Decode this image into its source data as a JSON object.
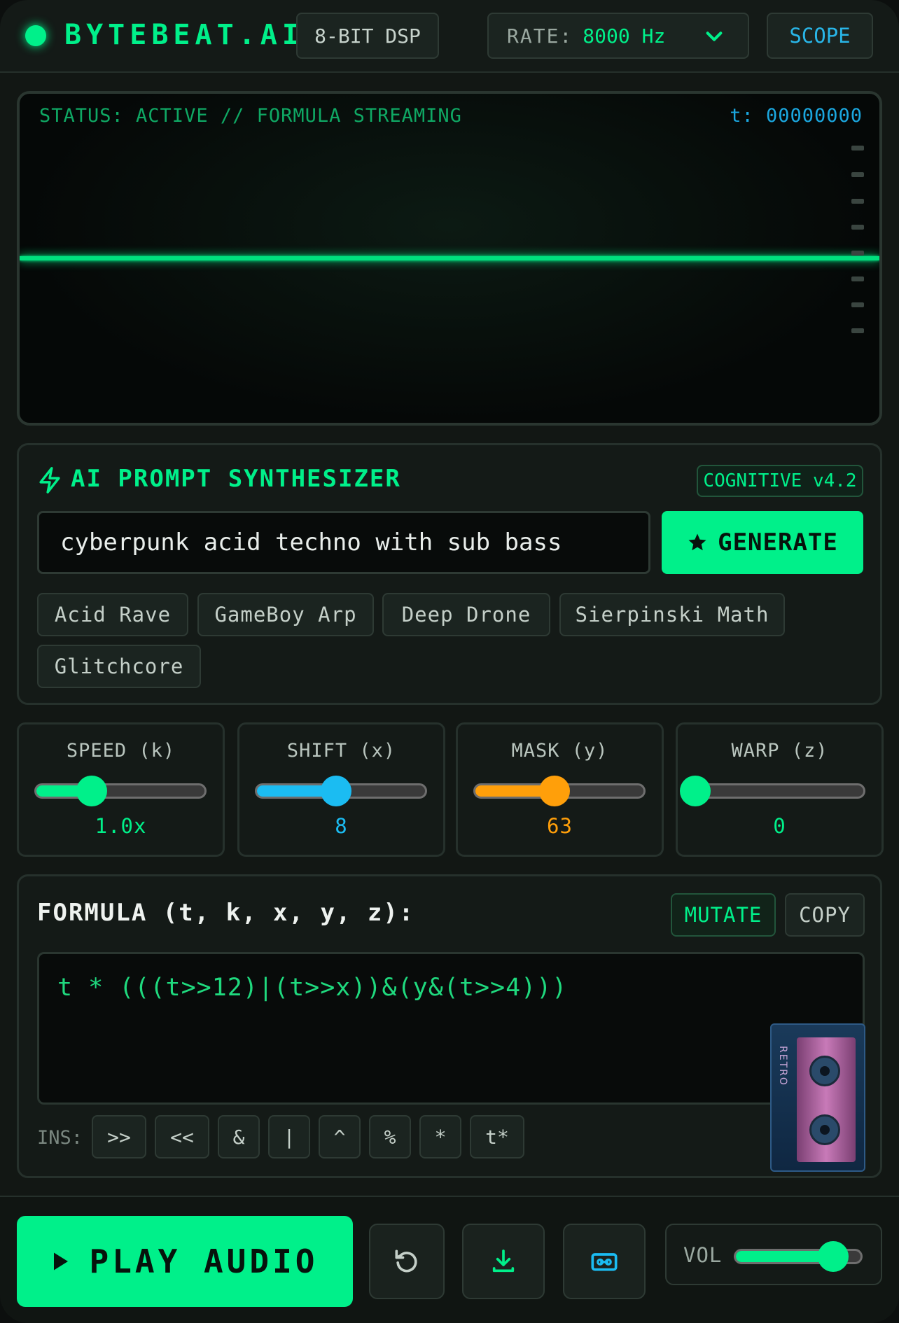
{
  "header": {
    "brand": "BYTEBEAT.AI",
    "dsp_badge": "8-BIT DSP",
    "rate_label": "RATE:",
    "rate_value": "8000 Hz",
    "scope_button": "SCOPE"
  },
  "scope": {
    "status": "STATUS: ACTIVE // FORMULA STREAMING",
    "t_counter": "t: 00000000"
  },
  "synth": {
    "title": "AI PROMPT SYNTHESIZER",
    "version": "COGNITIVE v4.2",
    "prompt_value": "cyberpunk acid techno with sub bass",
    "generate_label": "GENERATE",
    "presets": [
      "Acid Rave",
      "GameBoy Arp",
      "Deep Drone",
      "Sierpinski Math",
      "Glitchcore"
    ]
  },
  "knobs": [
    {
      "label": "SPEED (k)",
      "value": "1.0x",
      "level": 0.33,
      "color": "#00f08a"
    },
    {
      "label": "SHIFT (x)",
      "value": "8",
      "level": 0.47,
      "color": "#1bbcf2"
    },
    {
      "label": "MASK (y)",
      "value": "63",
      "level": 0.47,
      "color": "#ff9f0a"
    },
    {
      "label": "WARP (z)",
      "value": "0",
      "level": 0.0,
      "color": "#00f08a"
    }
  ],
  "formula": {
    "title": "FORMULA (t, k, x, y, z):",
    "mutate_label": "MUTATE",
    "copy_label": "COPY",
    "code": "t * (((t>>12)|(t>>x))&(y&(t>>4)))",
    "ins_label": "INS:",
    "ins_tokens": [
      ">>",
      "<<",
      "&",
      "|",
      "^",
      "%",
      "*",
      "t*"
    ],
    "cassette_label": "RETRO"
  },
  "transport": {
    "play_label": "PLAY AUDIO",
    "vol_label": "VOL",
    "volume": 0.78
  },
  "colors": {
    "accent": "#00f08a",
    "cyan": "#1bbcf2",
    "orange": "#ff9f0a"
  }
}
